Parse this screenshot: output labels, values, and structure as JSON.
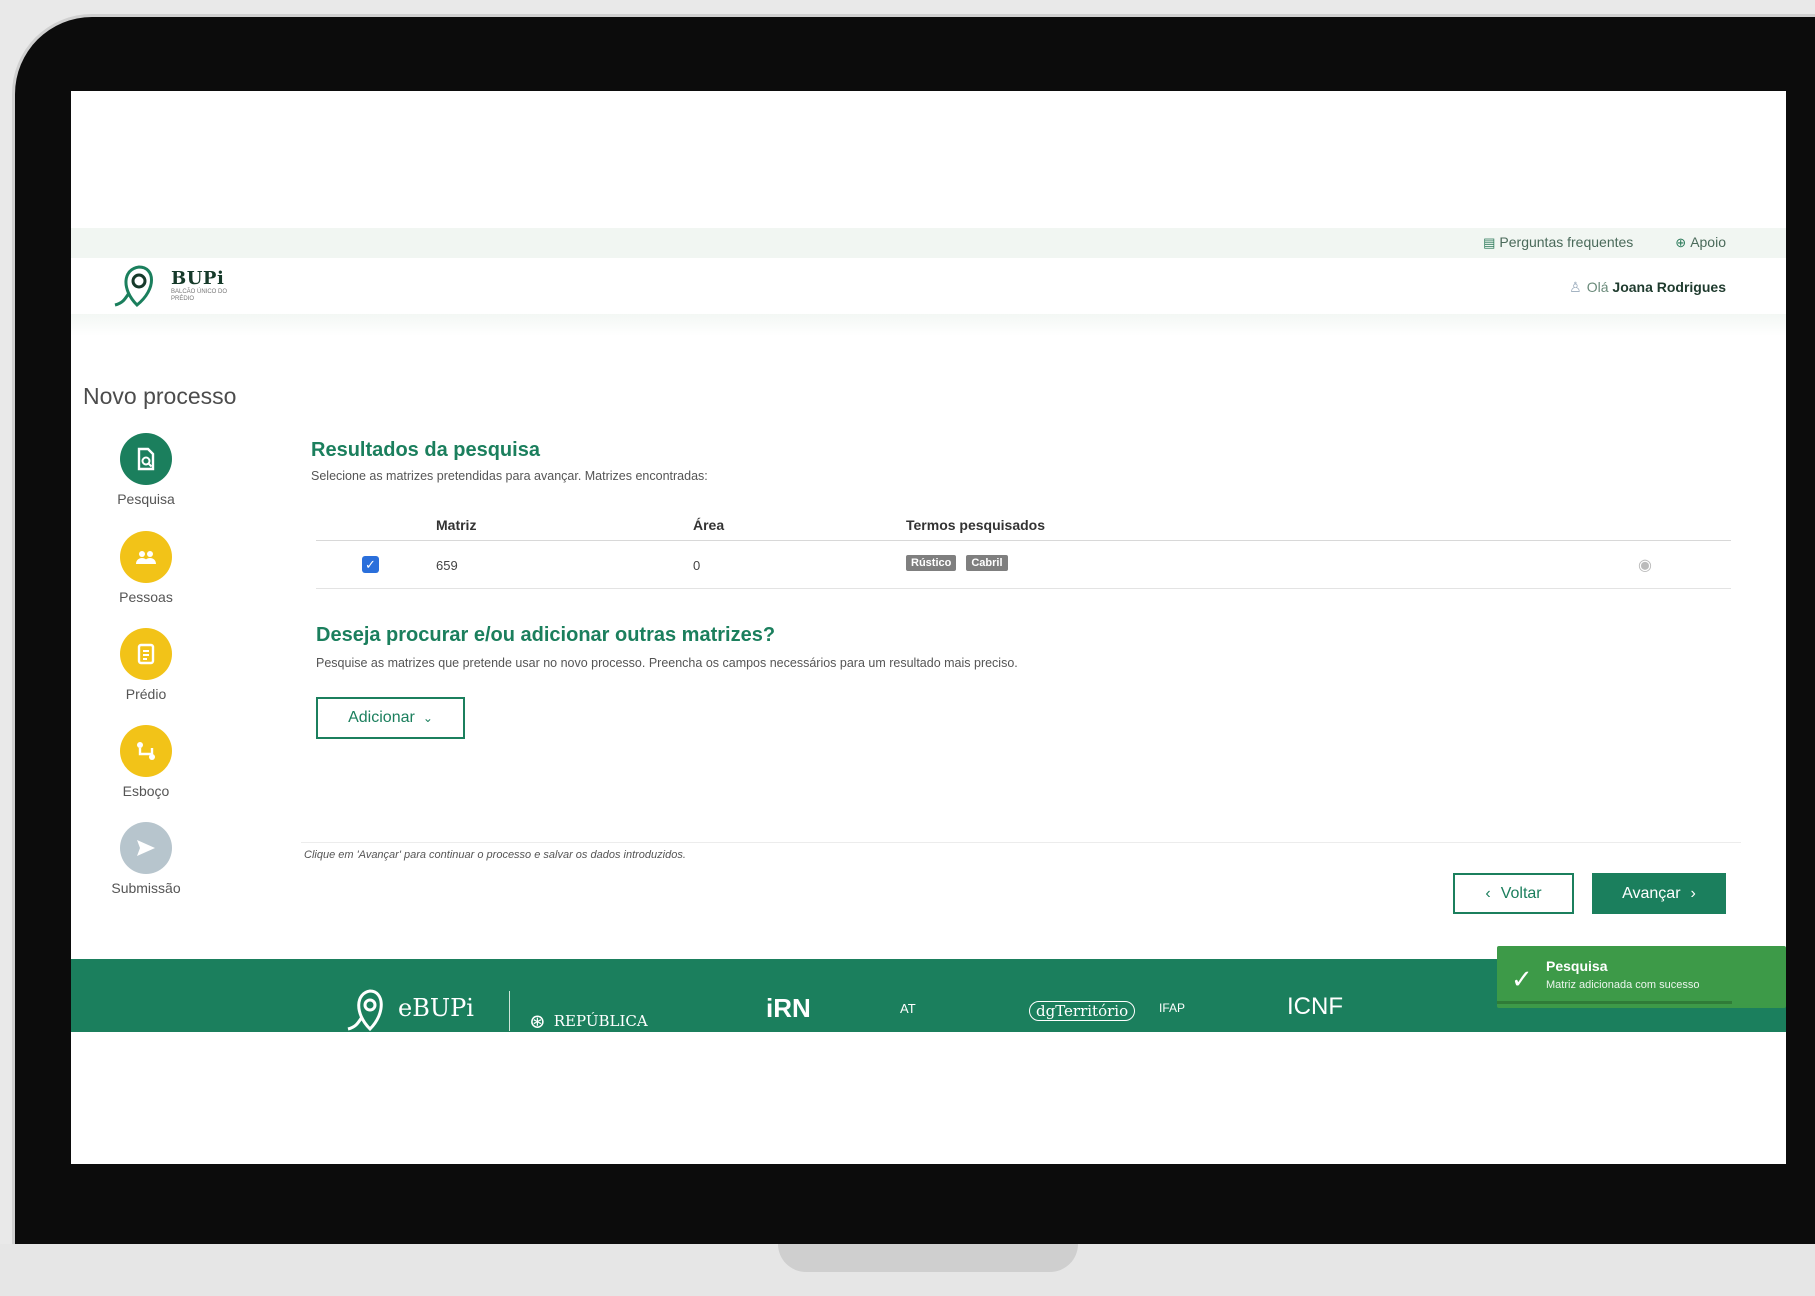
{
  "topbar": {
    "faq_label": "Perguntas frequentes",
    "support_label": "Apoio"
  },
  "logo": {
    "title": "BUPi",
    "subtitle": "BALCÃO ÚNICO DO PRÉDIO"
  },
  "user": {
    "greeting": "Olá",
    "name": "Joana Rodrigues"
  },
  "page": {
    "title": "Novo processo"
  },
  "steps": [
    {
      "label": "Pesquisa",
      "icon": "search-document-icon",
      "state": "active"
    },
    {
      "label": "Pessoas",
      "icon": "people-icon",
      "state": "pending"
    },
    {
      "label": "Prédio",
      "icon": "document-icon",
      "state": "pending"
    },
    {
      "label": "Esboço",
      "icon": "path-icon",
      "state": "pending"
    },
    {
      "label": "Submissão",
      "icon": "send-icon",
      "state": "disabled"
    }
  ],
  "results": {
    "title": "Resultados da pesquisa",
    "subtitle": "Selecione as matrizes pretendidas para avançar. Matrizes encontradas:",
    "columns": [
      "Matriz",
      "Área",
      "Termos pesquisados"
    ],
    "rows": [
      {
        "checked": true,
        "matriz": "659",
        "area": "0",
        "terms": [
          "Rústico",
          "Cabril"
        ]
      }
    ]
  },
  "add_section": {
    "title": "Deseja procurar e/ou adicionar outras matrizes?",
    "subtitle": "Pesquise as matrizes que pretende usar no novo processo. Preencha os campos necessários para um resultado mais preciso.",
    "button_label": "Adicionar"
  },
  "navigation": {
    "hint": "Clique em 'Avançar' para continuar o processo e salvar os dados introduzidos.",
    "back_label": "Voltar",
    "next_label": "Avançar"
  },
  "footer": {
    "logo_text": "eBUPi",
    "republic_text": "REPÚBLICA",
    "partners": [
      "iRN",
      "AT",
      "dgTerritório",
      "IFAP",
      "ICNF"
    ]
  },
  "toast": {
    "title": "Pesquisa",
    "message": "Matriz adicionada com sucesso"
  },
  "colors": {
    "brand_green": "#1b7f5d",
    "step_yellow": "#f2c318",
    "toast_green": "#3d9a48"
  }
}
